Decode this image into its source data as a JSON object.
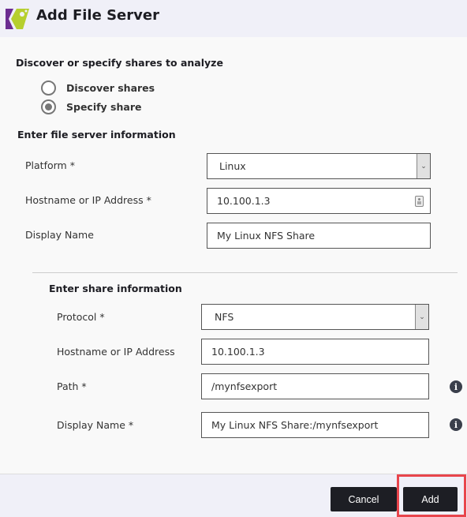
{
  "header": {
    "title": "Add File Server",
    "logo_icon": "app-logo",
    "colors": {
      "logo_purple": "#6b2c91",
      "logo_green": "#b6cf2e"
    }
  },
  "discover": {
    "title": "Discover or specify shares to analyze",
    "options": [
      {
        "label": "Discover shares",
        "checked": false
      },
      {
        "label": "Specify share",
        "checked": true
      }
    ]
  },
  "server": {
    "title": "Enter file server information",
    "platform": {
      "label": "Platform *",
      "value": "Linux"
    },
    "hostname": {
      "label": "Hostname or IP Address *",
      "value": "10.100.1.3"
    },
    "display_name": {
      "label": "Display Name",
      "value": "My Linux NFS Share"
    }
  },
  "share": {
    "title": "Enter share information",
    "protocol": {
      "label": "Protocol *",
      "value": "NFS"
    },
    "hostname": {
      "label": "Hostname or IP Address",
      "value": "10.100.1.3"
    },
    "path": {
      "label": "Path *",
      "value": "/mynfsexport"
    },
    "display_name": {
      "label": "Display Name *",
      "value": "My Linux NFS Share:/mynfsexport"
    },
    "info_glyph": "i"
  },
  "footer": {
    "cancel_label": "Cancel",
    "add_label": "Add",
    "highlight_color": "#e8454c"
  }
}
